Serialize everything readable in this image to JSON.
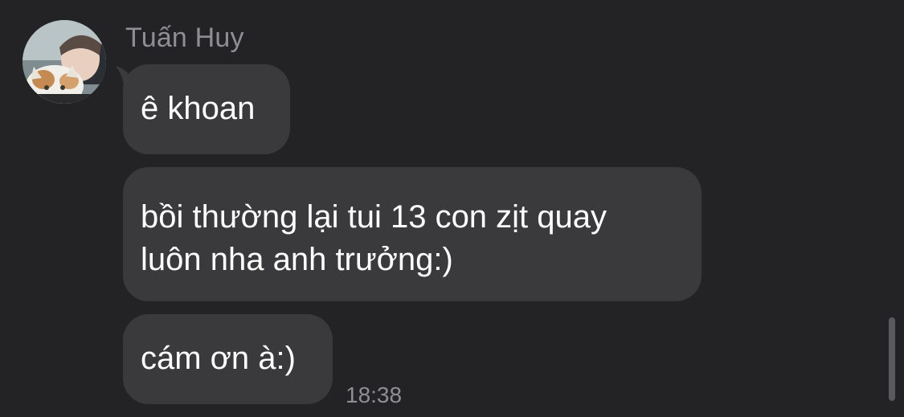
{
  "conversation": {
    "sender_name": "Tuấn Huy",
    "avatar_icon": "profile-photo-person-with-cat",
    "messages": [
      {
        "text": "ê khoan"
      },
      {
        "text_line1": "bồi thường lại tui 13 con zịt quay",
        "text_line2": "luôn nha anh trưởng:)"
      },
      {
        "text": "cám ơn à:)"
      }
    ],
    "timestamp": "18:38"
  },
  "colors": {
    "background": "#232325",
    "bubble": "#3a3a3c",
    "text": "#ffffff",
    "secondary_text": "#8e8e93"
  }
}
